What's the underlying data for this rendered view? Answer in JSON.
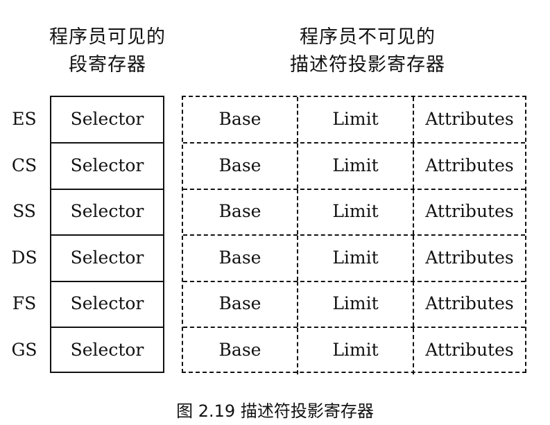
{
  "headings": {
    "visible": [
      "程序员可见的",
      "段寄存器"
    ],
    "invisible": [
      "程序员不可见的",
      "描述符投影寄存器"
    ]
  },
  "rows": [
    {
      "segment": "ES",
      "selector": "Selector",
      "base": "Base",
      "limit": "Limit",
      "attributes": "Attributes"
    },
    {
      "segment": "CS",
      "selector": "Selector",
      "base": "Base",
      "limit": "Limit",
      "attributes": "Attributes"
    },
    {
      "segment": "SS",
      "selector": "Selector",
      "base": "Base",
      "limit": "Limit",
      "attributes": "Attributes"
    },
    {
      "segment": "DS",
      "selector": "Selector",
      "base": "Base",
      "limit": "Limit",
      "attributes": "Attributes"
    },
    {
      "segment": "FS",
      "selector": "Selector",
      "base": "Base",
      "limit": "Limit",
      "attributes": "Attributes"
    },
    {
      "segment": "GS",
      "selector": "Selector",
      "base": "Base",
      "limit": "Limit",
      "attributes": "Attributes"
    }
  ],
  "caption": "图 2.19 描述符投影寄存器"
}
